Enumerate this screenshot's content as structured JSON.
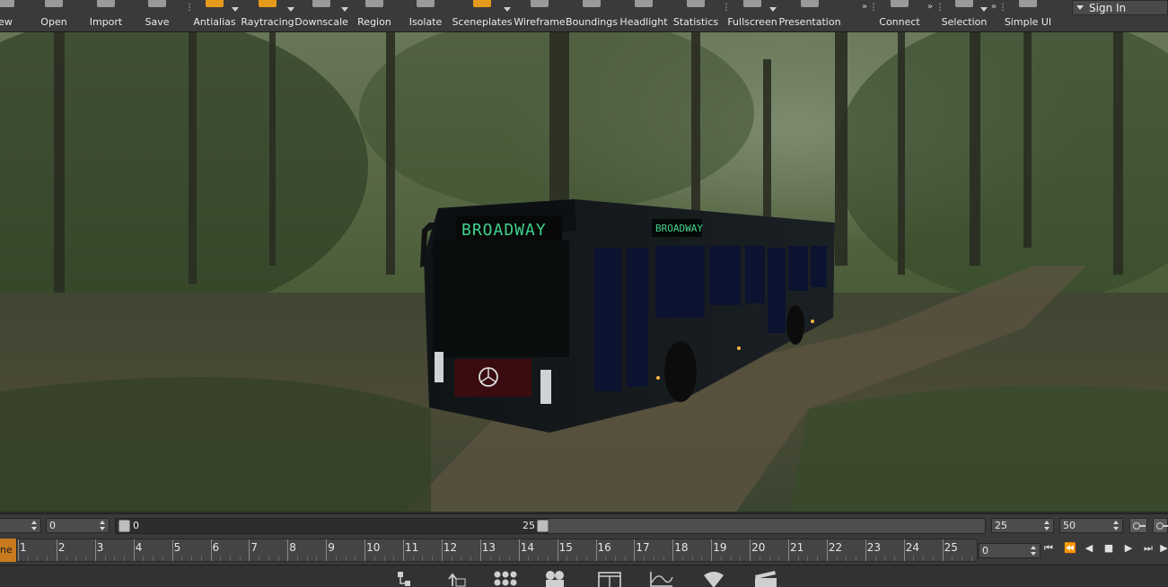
{
  "toolbar": {
    "items": [
      {
        "label": "ew",
        "icon": "new-icon"
      },
      {
        "label": "Open",
        "icon": "folder-icon"
      },
      {
        "label": "Import",
        "icon": "import-icon"
      },
      {
        "label": "Save",
        "icon": "save-icon"
      },
      {
        "label": "Antialias",
        "icon": "antialias-icon"
      },
      {
        "label": "Raytracing",
        "icon": "raytracing-icon"
      },
      {
        "label": "Downscale",
        "icon": "downscale-icon"
      },
      {
        "label": "Region",
        "icon": "region-icon"
      },
      {
        "label": "Isolate",
        "icon": "isolate-icon"
      },
      {
        "label": "Sceneplates",
        "icon": "sceneplates-icon"
      },
      {
        "label": "Wireframe",
        "icon": "wireframe-icon"
      },
      {
        "label": "Boundings",
        "icon": "boundings-icon"
      },
      {
        "label": "Headlight",
        "icon": "headlight-icon"
      },
      {
        "label": "Statistics",
        "icon": "statistics-icon"
      },
      {
        "label": "Fullscreen",
        "icon": "fullscreen-icon"
      },
      {
        "label": "Presentation",
        "icon": "presentation-icon"
      },
      {
        "label": "Connect",
        "icon": "connect-icon"
      },
      {
        "label": "Selection",
        "icon": "selection-icon"
      },
      {
        "label": "Simple UI",
        "icon": "simple-ui-icon"
      }
    ],
    "sign_in": "Sign In"
  },
  "viewport": {
    "bus_sign_rear": "BROADWAY",
    "bus_sign_side": "BROADWAY"
  },
  "slider_row": {
    "left_spin_value": "",
    "start_spin_value": "0",
    "range_start_label": "0",
    "range_current_label": "25",
    "range_current": 25,
    "range_max": 50,
    "end_current_value": "25",
    "end_max_value": "50"
  },
  "timeline": {
    "frame_marker_text": "ne",
    "ticks": [
      "1",
      "2",
      "3",
      "4",
      "5",
      "6",
      "7",
      "8",
      "9",
      "10",
      "11",
      "12",
      "13",
      "14",
      "15",
      "16",
      "17",
      "18",
      "19",
      "20",
      "21",
      "22",
      "23",
      "24",
      "25"
    ],
    "current_frame_value": "0"
  },
  "colors": {
    "accent": "#e59a1b",
    "toolbar_bg": "#3a3a3a",
    "sign_green": "#3fd18a"
  }
}
